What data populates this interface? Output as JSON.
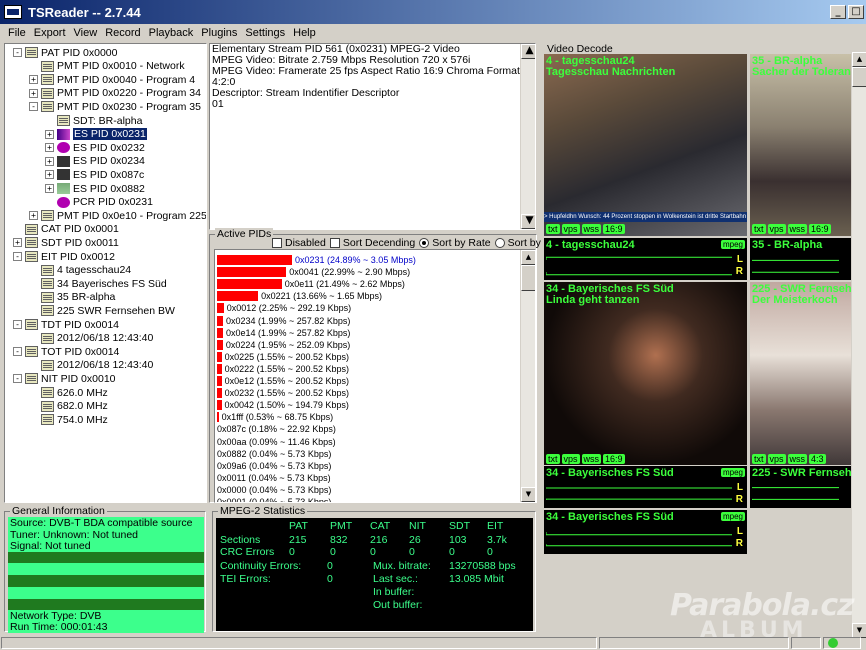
{
  "window": {
    "title": "TSReader -- 2.7.44"
  },
  "menu": [
    "File",
    "Export",
    "View",
    "Record",
    "Playback",
    "Plugins",
    "Settings",
    "Help"
  ],
  "tree": [
    {
      "label": "PAT PID 0x0000",
      "indent": 0,
      "exp": "-",
      "icon": "page"
    },
    {
      "label": "PMT PID 0x0010 - Network",
      "indent": 1,
      "exp": "",
      "icon": "page"
    },
    {
      "label": "PMT PID 0x0040 - Program 4",
      "indent": 1,
      "exp": "+",
      "icon": "page"
    },
    {
      "label": "PMT PID 0x0220 - Program 34",
      "indent": 1,
      "exp": "+",
      "icon": "page"
    },
    {
      "label": "PMT PID 0x0230 - Program 35",
      "indent": 1,
      "exp": "-",
      "icon": "page"
    },
    {
      "label": "SDT: BR-alpha",
      "indent": 2,
      "exp": "",
      "icon": "page"
    },
    {
      "label": "ES PID 0x0231",
      "indent": 2,
      "exp": "+",
      "icon": "vid",
      "selected": true
    },
    {
      "label": "ES PID 0x0232",
      "indent": 2,
      "exp": "+",
      "icon": "purple"
    },
    {
      "label": "ES PID 0x0234",
      "indent": 2,
      "exp": "+",
      "icon": "dark"
    },
    {
      "label": "ES PID 0x087c",
      "indent": 2,
      "exp": "+",
      "icon": "dark"
    },
    {
      "label": "ES PID 0x0882",
      "indent": 2,
      "exp": "+",
      "icon": "grid"
    },
    {
      "label": "PCR PID 0x0231",
      "indent": 2,
      "exp": "",
      "icon": "purple"
    },
    {
      "label": "PMT PID 0x0e10 - Program 225",
      "indent": 1,
      "exp": "+",
      "icon": "page"
    },
    {
      "label": "CAT PID 0x0001",
      "indent": 0,
      "exp": "",
      "icon": "page"
    },
    {
      "label": "SDT PID 0x0011",
      "indent": 0,
      "exp": "+",
      "icon": "page"
    },
    {
      "label": "EIT PID 0x0012",
      "indent": 0,
      "exp": "-",
      "icon": "page"
    },
    {
      "label": "4 tagesschau24",
      "indent": 1,
      "exp": "",
      "icon": "page"
    },
    {
      "label": "34 Bayerisches FS Süd",
      "indent": 1,
      "exp": "",
      "icon": "page"
    },
    {
      "label": "35 BR-alpha",
      "indent": 1,
      "exp": "",
      "icon": "page"
    },
    {
      "label": "225 SWR Fernsehen BW",
      "indent": 1,
      "exp": "",
      "icon": "page"
    },
    {
      "label": "TDT PID 0x0014",
      "indent": 0,
      "exp": "-",
      "icon": "page"
    },
    {
      "label": "2012/06/18 12:43:40",
      "indent": 1,
      "exp": "",
      "icon": "page"
    },
    {
      "label": "TOT PID 0x0014",
      "indent": 0,
      "exp": "-",
      "icon": "page"
    },
    {
      "label": "2012/06/18 12:43:40",
      "indent": 1,
      "exp": "",
      "icon": "page"
    },
    {
      "label": "NIT PID 0x0010",
      "indent": 0,
      "exp": "-",
      "icon": "page"
    },
    {
      "label": "626.0 MHz",
      "indent": 1,
      "exp": "",
      "icon": "page"
    },
    {
      "label": "682.0 MHz",
      "indent": 1,
      "exp": "",
      "icon": "page"
    },
    {
      "label": "754.0 MHz",
      "indent": 1,
      "exp": "",
      "icon": "page"
    }
  ],
  "info_lines": [
    "Elementary Stream PID 561 (0x0231) MPEG-2 Video",
    "MPEG Video: Bitrate 2.759 Mbps Resolution 720 x 576i",
    "MPEG Video: Framerate 25 fps Aspect Ratio 16:9 Chroma Format 4:2:0",
    "Descriptor: Stream Indentifier Descriptor",
    " 01"
  ],
  "active_pids": {
    "label": "Active PIDs",
    "disabled_label": "Disabled",
    "sort_desc_label": "Sort Decending",
    "sort_rate_label": "Sort by Rate",
    "sort_pid_label": "Sort by PID",
    "rows": [
      {
        "text": "0x0231 (24.89% ~ 3.05 Mbps)",
        "pct": 24.89,
        "highlight": true
      },
      {
        "text": "0x0041 (22.99% ~ 2.90 Mbps)",
        "pct": 22.99
      },
      {
        "text": "0x0e11 (21.49% ~ 2.62 Mbps)",
        "pct": 21.49
      },
      {
        "text": "0x0221 (13.66% ~ 1.65 Mbps)",
        "pct": 13.66
      },
      {
        "text": "0x0012 (2.25% ~ 292.19 Kbps)",
        "pct": 2.25
      },
      {
        "text": "0x0234 (1.99% ~ 257.82 Kbps)",
        "pct": 1.99
      },
      {
        "text": "0x0e14 (1.99% ~ 257.82 Kbps)",
        "pct": 1.99
      },
      {
        "text": "0x0224 (1.95% ~ 252.09 Kbps)",
        "pct": 1.95
      },
      {
        "text": "0x0225 (1.55% ~ 200.52 Kbps)",
        "pct": 1.55
      },
      {
        "text": "0x0222 (1.55% ~ 200.52 Kbps)",
        "pct": 1.55
      },
      {
        "text": "0x0e12 (1.55% ~ 200.52 Kbps)",
        "pct": 1.55
      },
      {
        "text": "0x0232 (1.55% ~ 200.52 Kbps)",
        "pct": 1.55
      },
      {
        "text": "0x0042 (1.50% ~ 194.79 Kbps)",
        "pct": 1.5
      },
      {
        "text": "0x1fff (0.53% ~ 68.75 Kbps)",
        "pct": 0.53
      },
      {
        "text": "0x087c (0.18% ~ 22.92 Kbps)",
        "pct": 0.18
      },
      {
        "text": "0x00aa (0.09% ~ 11.46 Kbps)",
        "pct": 0.09
      },
      {
        "text": "0x0882 (0.04% ~ 5.73 Kbps)",
        "pct": 0.04
      },
      {
        "text": "0x09a6 (0.04% ~ 5.73 Kbps)",
        "pct": 0.04
      },
      {
        "text": "0x0011 (0.04% ~ 5.73 Kbps)",
        "pct": 0.04
      },
      {
        "text": "0x0000 (0.04% ~ 5.73 Kbps)",
        "pct": 0.04
      },
      {
        "text": "0x0001 (0.04% ~ 5.73 Kbps)",
        "pct": 0.04
      }
    ]
  },
  "general_info": {
    "label": "General Information",
    "lines": [
      {
        "text": "Source: DVB-T BDA compatible source",
        "light": true
      },
      {
        "text": "Tuner: Unknown: Not tuned",
        "light": true
      },
      {
        "text": "Signal: Not tuned",
        "light": true
      },
      {
        "text": "",
        "light": false
      },
      {
        "text": "",
        "light": true
      },
      {
        "text": "",
        "light": false
      },
      {
        "text": "",
        "light": true
      },
      {
        "text": "",
        "light": false
      },
      {
        "text": "Network Type: DVB",
        "light": true
      },
      {
        "text": "Run Time: 000:01:43",
        "light": true
      }
    ]
  },
  "mpeg_stats": {
    "label": "MPEG-2 Statistics",
    "headers": [
      "PAT",
      "PMT",
      "CAT",
      "NIT",
      "SDT",
      "EIT"
    ],
    "sections_label": "Sections",
    "sections": [
      "215",
      "832",
      "216",
      "26",
      "103",
      "3.7k"
    ],
    "crc_label": "CRC Errors",
    "crc": [
      "0",
      "0",
      "0",
      "0",
      "0",
      "0"
    ],
    "cont_label": "Continuity Errors:",
    "cont_val": "0",
    "tei_label": "TEI Errors:",
    "tei_val": "0",
    "mux_label": "Mux. bitrate:",
    "mux_val": "13270588 bps",
    "last_label": "Last sec.:",
    "last_val": "13.085 Mbit",
    "inbuf_label": "In buffer:",
    "outbuf_label": "Out buffer:"
  },
  "video_decode": {
    "label": "Video Decode",
    "tiles": [
      {
        "title": "4 - tagesschau24",
        "subtitle": "Tagesschau Nachrichten",
        "ticker": "> Hupfeldhn Wunsch: 44 Prozent stoppen in Wolkenstein ist dritte Startbahn"
      },
      {
        "title": "35 - BR-alpha",
        "subtitle": "Sacher der Toleranz"
      },
      {
        "title": "34 - Bayerisches FS Süd",
        "subtitle": "Linda geht tanzen"
      },
      {
        "title": "225 - SWR Fernsehe",
        "subtitle": "Der Meisterkoch"
      }
    ],
    "audio": [
      {
        "title": "4 - tagesschau24",
        "mpeg": "mpeg"
      },
      {
        "title": "35 - BR-alpha"
      },
      {
        "title": "34 - Bayerisches FS Süd",
        "mpeg": "mpeg"
      },
      {
        "title": "225 - SWR Fernsehe"
      },
      {
        "title": "34 - Bayerisches FS Süd",
        "mpeg": "mpeg"
      }
    ],
    "tags": [
      "txt",
      "vps",
      "wss",
      "16:9"
    ],
    "tags_43": [
      "txt",
      "vps",
      "wss",
      "4:3"
    ],
    "l": "L",
    "r": "R"
  },
  "watermark": {
    "line1": "Parabola.cz",
    "line2": "ALBUM"
  }
}
